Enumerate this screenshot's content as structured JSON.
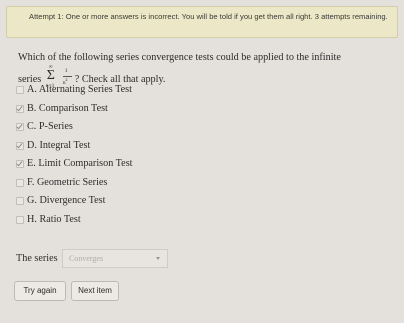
{
  "alert": {
    "text": "Attempt 1: One or more answers is incorrect. You will be told if you get them all right. 3 attempts remaining."
  },
  "question": {
    "line1": "Which of the following series convergence tests could be applied to the infinite",
    "line2_prefix": "series",
    "sum_upper": "∞",
    "sum_symbol": "Σ",
    "sum_lower": "n=1",
    "frac_num": "1",
    "frac_den": "n",
    "frac_den_exp": "2",
    "line2_suffix": "? Check all that apply."
  },
  "options": [
    {
      "label": "A. Alternating Series Test",
      "checked": false
    },
    {
      "label": "B. Comparison Test",
      "checked": true
    },
    {
      "label": "C. P-Series",
      "checked": true
    },
    {
      "label": "D. Integral Test",
      "checked": true
    },
    {
      "label": "E. Limit Comparison Test",
      "checked": true
    },
    {
      "label": "F. Geometric Series",
      "checked": false
    },
    {
      "label": "G. Divergence Test",
      "checked": false
    },
    {
      "label": "H. Ratio Test",
      "checked": false
    }
  ],
  "series": {
    "label": "The series",
    "select_value": "Converges"
  },
  "buttons": {
    "try_again": "Try again",
    "next_item": "Next item"
  }
}
